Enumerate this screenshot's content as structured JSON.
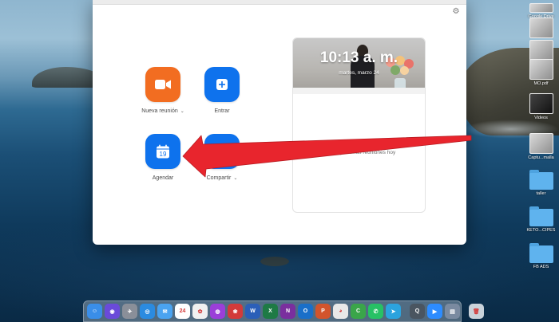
{
  "desktop": {
    "icons": [
      {
        "label": "Google Drive",
        "kind": "thumb"
      },
      {
        "label": "",
        "kind": "thumb"
      },
      {
        "label": "",
        "kind": "thumb"
      },
      {
        "label": "MO.pdf",
        "kind": "thumb"
      },
      {
        "label": "Videos",
        "kind": "thumb-dark"
      },
      {
        "label": "Captu...malla",
        "kind": "thumb"
      },
      {
        "label": "taller",
        "kind": "folder"
      },
      {
        "label": "KETO...CIPES",
        "kind": "folder"
      },
      {
        "label": "FB ADS",
        "kind": "folder"
      }
    ]
  },
  "zoom": {
    "settings_icon": "gear-icon",
    "actions": {
      "new_meeting": {
        "label": "Nueva reunión",
        "icon": "video-camera-icon",
        "color": "#f26d21"
      },
      "join": {
        "label": "Entrar",
        "icon": "plus-icon",
        "color": "#0e72ed"
      },
      "schedule": {
        "label": "Agendar",
        "icon": "calendar-icon",
        "day": "19",
        "color": "#0e72ed"
      },
      "share": {
        "label": "Compartir",
        "icon": "share-screen-icon",
        "color": "#0e72ed"
      }
    },
    "panel": {
      "time": "10:13 a. m.",
      "date": "martes, marzo 24",
      "empty_message": "No hay próximas reuniones hoy"
    }
  },
  "annotation": {
    "color": "#e8252d"
  },
  "dock": {
    "apps": [
      {
        "name": "finder-icon",
        "color": "#3a8ee8",
        "glyph": "☺"
      },
      {
        "name": "siri-icon",
        "color": "#6a4ad9",
        "glyph": "◉"
      },
      {
        "name": "launchpad-icon",
        "color": "#8a8f99",
        "glyph": "✈"
      },
      {
        "name": "safari-icon",
        "color": "#2b8be0",
        "glyph": "◎"
      },
      {
        "name": "mail-icon",
        "color": "#4aa3f0",
        "glyph": "✉"
      },
      {
        "name": "calendar-icon",
        "color": "#ffffff",
        "glyph": "24"
      },
      {
        "name": "photos-icon",
        "color": "#f0f0f0",
        "glyph": "✿"
      },
      {
        "name": "podcasts-icon",
        "color": "#9b3ed8",
        "glyph": "◍"
      },
      {
        "name": "photo-booth-icon",
        "color": "#d33a3a",
        "glyph": "❀"
      },
      {
        "name": "word-icon",
        "color": "#2b5fb8",
        "glyph": "W"
      },
      {
        "name": "excel-icon",
        "color": "#1e7a45",
        "glyph": "X"
      },
      {
        "name": "onenote-icon",
        "color": "#7a2f9e",
        "glyph": "N"
      },
      {
        "name": "outlook-icon",
        "color": "#1a6fc9",
        "glyph": "O"
      },
      {
        "name": "powerpoint-icon",
        "color": "#d2542c",
        "glyph": "P"
      },
      {
        "name": "chrome-icon",
        "color": "#e8e8e8",
        "glyph": "◕"
      },
      {
        "name": "camtasia-icon",
        "color": "#3aa54a",
        "glyph": "C"
      },
      {
        "name": "whatsapp-icon",
        "color": "#27c165",
        "glyph": "✆"
      },
      {
        "name": "telegram-icon",
        "color": "#2ca3de",
        "glyph": "➤"
      }
    ],
    "extras": [
      {
        "name": "quicktime-icon",
        "color": "#4a5560",
        "glyph": "Q"
      },
      {
        "name": "zoom-icon",
        "color": "#2d8cff",
        "glyph": "▶"
      },
      {
        "name": "preview-icon",
        "color": "#7a8aa0",
        "glyph": "▤"
      }
    ],
    "trash": {
      "name": "trash-icon",
      "color": "#c9d2da",
      "glyph": "🗑"
    }
  }
}
